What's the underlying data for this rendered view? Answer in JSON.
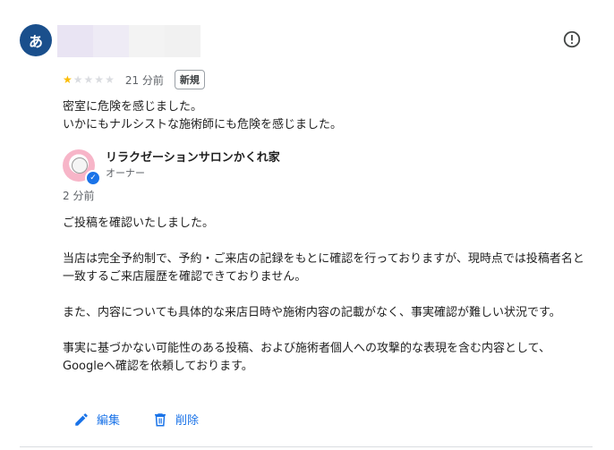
{
  "reviewer": {
    "avatar_letter": "あ"
  },
  "review": {
    "rating": 1,
    "max_rating": 5,
    "time": "21 分前",
    "badge": "新規",
    "lines": [
      "密室に危険を感じました。",
      "いかにもナルシストな施術師にも危険を感じました。"
    ]
  },
  "owner": {
    "name": "リラクゼーションサロンかくれ家",
    "role": "オーナー",
    "reply_time": "2 分前",
    "reply_paragraphs": [
      "ご投稿を確認いたしました。",
      "当店は完全予約制で、予約・ご来店の記録をもとに確認を行っておりますが、現時点では投稿者名と一致するご来店履歴を確認できておりません。",
      "また、内容についても具体的な来店日時や施術内容の記載がなく、事実確認が難しい状況です。",
      "事実に基づかない可能性のある投稿、および施術者個人への攻撃的な表現を含む内容として、Googleへ確認を依頼しております。"
    ]
  },
  "actions": {
    "edit_label": "編集",
    "delete_label": "削除"
  },
  "colors": {
    "accent": "#1a73e8",
    "star_on": "#fbbc04",
    "star_off": "#dadce0",
    "avatar_bg": "#1a4f8c"
  }
}
